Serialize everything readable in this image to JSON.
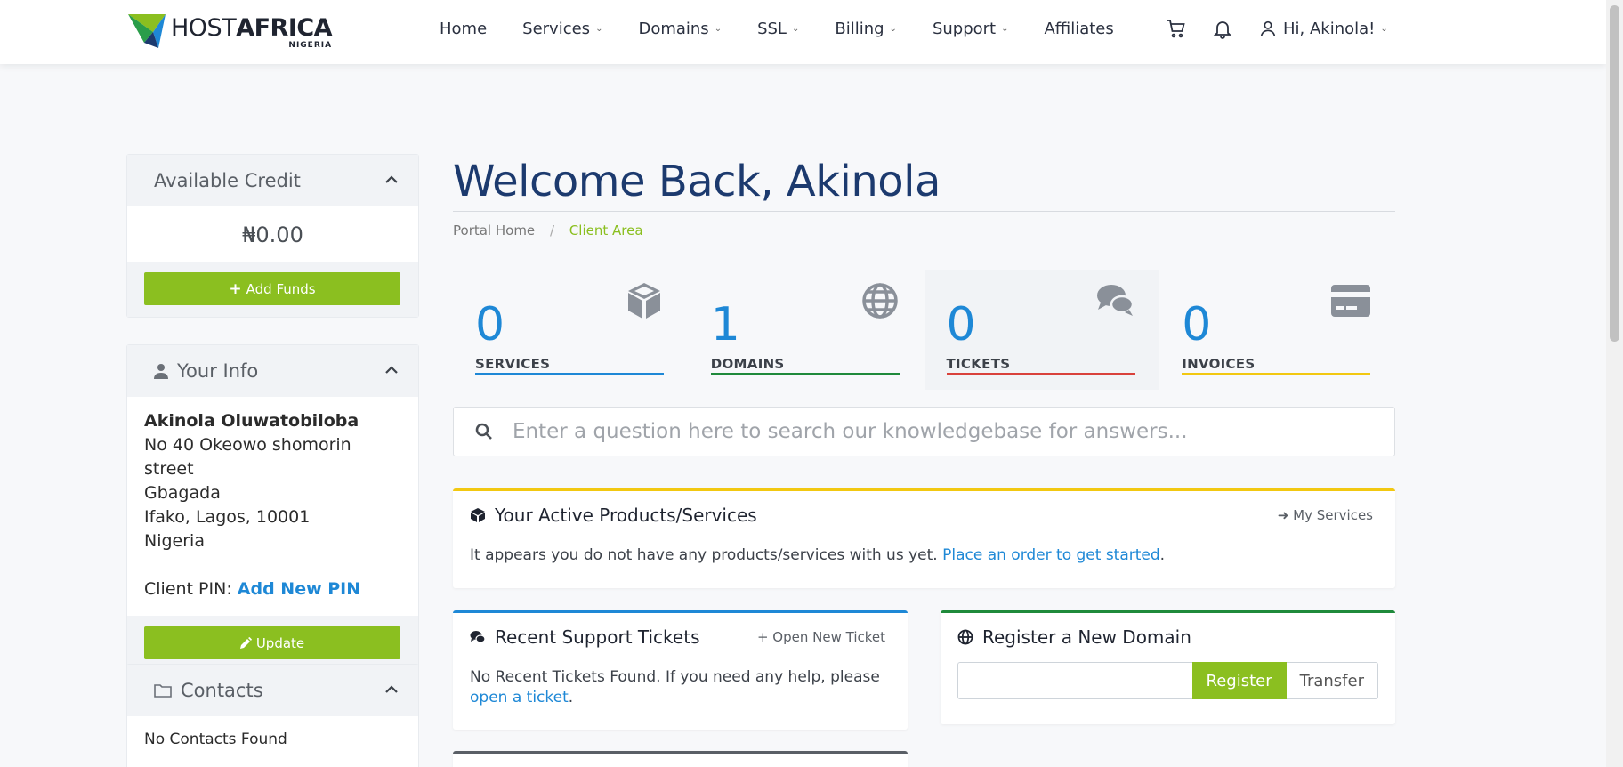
{
  "brand": {
    "name_light": "HOST",
    "name_bold": "AFRICA",
    "sub": "NIGERIA"
  },
  "nav": [
    {
      "label": "Home",
      "dropdown": false
    },
    {
      "label": "Services",
      "dropdown": true
    },
    {
      "label": "Domains",
      "dropdown": true
    },
    {
      "label": "SSL",
      "dropdown": true
    },
    {
      "label": "Billing",
      "dropdown": true
    },
    {
      "label": "Support",
      "dropdown": true
    },
    {
      "label": "Affiliates",
      "dropdown": false
    }
  ],
  "header": {
    "greeting": "Hi, Akinola!"
  },
  "sidebar": {
    "credit": {
      "title": "Available Credit",
      "value": "₦0.00",
      "button": "Add Funds"
    },
    "info": {
      "title": "Your Info",
      "name": "Akinola Oluwatobiloba",
      "address_lines": [
        "No 40 Okeowo shomorin street",
        "Gbagada",
        "Ifako, Lagos, 10001",
        "Nigeria"
      ],
      "pin_label": "Client PIN:",
      "pin_link": "Add New PIN",
      "button": "Update"
    },
    "contacts": {
      "title": "Contacts",
      "empty": "No Contacts Found"
    }
  },
  "main": {
    "title": "Welcome Back, Akinola",
    "breadcrumb": {
      "home": "Portal Home",
      "sep": "/",
      "current": "Client Area"
    },
    "stats": [
      {
        "value": "0",
        "label": "SERVICES",
        "color": "#1e88d6",
        "icon": "cube-icon"
      },
      {
        "value": "1",
        "label": "DOMAINS",
        "color": "#1f8a3b",
        "icon": "globe-icon"
      },
      {
        "value": "0",
        "label": "TICKETS",
        "color": "#d9413b",
        "icon": "comments-icon"
      },
      {
        "value": "0",
        "label": "INVOICES",
        "color": "#f2c811",
        "icon": "credit-card-icon"
      }
    ],
    "search_placeholder": "Enter a question here to search our knowledgebase for answers...",
    "products": {
      "title": "Your Active Products/Services",
      "link": "My Services",
      "text": "It appears you do not have any products/services with us yet.",
      "cta": "Place an order to get started",
      "accent": "#f2c811"
    },
    "tickets": {
      "title": "Recent Support Tickets",
      "link": "Open New Ticket",
      "text": "No Recent Tickets Found. If you need any help, please",
      "cta": "open a ticket",
      "accent": "#1e88d6"
    },
    "domain": {
      "title": "Register a New Domain",
      "register": "Register",
      "transfer": "Transfer",
      "accent": "#1f8a3b"
    }
  }
}
